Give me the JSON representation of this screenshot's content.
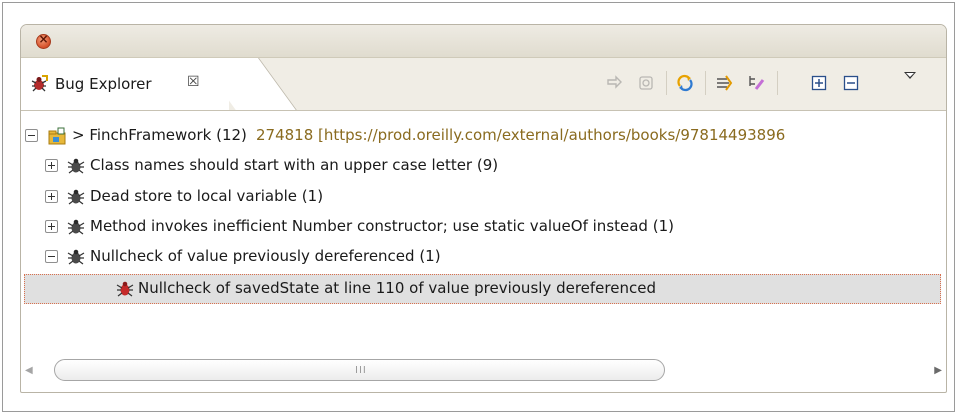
{
  "view": {
    "tab_label": "Bug Explorer",
    "tab_close_glyph": "☒",
    "toolbar": [
      "previous-icon",
      "refresh-icon",
      "sync-icon",
      "filter-icon",
      "group-icon",
      "expand-all-icon",
      "collapse-all-icon",
      "view-menu-icon"
    ]
  },
  "tree": {
    "project": {
      "label": "> FinchFramework (12)",
      "detail": "274818 [https://prod.oreilly.com/external/authors/books/97814493896",
      "expanded": true
    },
    "categories": [
      {
        "label": "Class names should start with an upper case letter (9)",
        "expanded": false
      },
      {
        "label": "Dead store to local variable (1)",
        "expanded": false
      },
      {
        "label": "Method invokes inefficient Number constructor; use static valueOf instead (1)",
        "expanded": false
      },
      {
        "label": "Nullcheck of value previously dereferenced (1)",
        "expanded": true
      }
    ],
    "selected_bug": {
      "label": "Nullcheck of savedState at line 110 of value previously dereferenced"
    }
  },
  "scrollbar": {
    "grip": "III"
  }
}
